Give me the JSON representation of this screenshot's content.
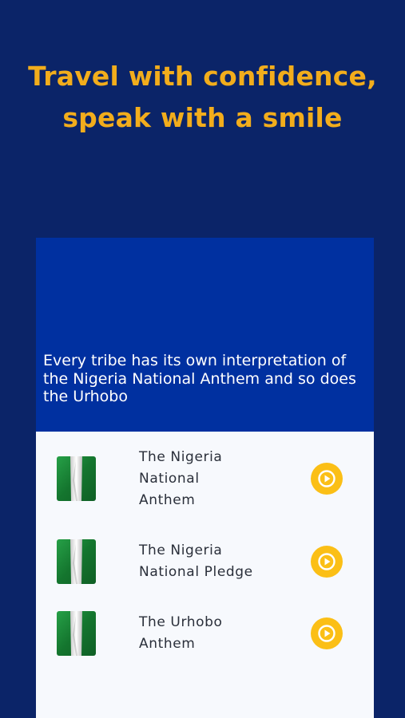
{
  "headline": {
    "line1": "Travel with confidence,",
    "line2": "speak with a smile"
  },
  "banner": {
    "text": "Every tribe has its own interpretation of the Nigeria National Anthem and so does the Urhobo"
  },
  "items": [
    {
      "label_lines": [
        "The Nigeria",
        "National",
        "Anthem"
      ],
      "icon": "nigeria-flag-icon",
      "action_icon": "play-icon"
    },
    {
      "label_lines": [
        "The Nigeria",
        "National Pledge"
      ],
      "icon": "nigeria-flag-icon",
      "action_icon": "play-icon"
    },
    {
      "label_lines": [
        "The Urhobo",
        "Anthem"
      ],
      "icon": "nigeria-flag-icon",
      "action_icon": "play-icon"
    }
  ],
  "colors": {
    "background": "#0b2468",
    "headline": "#f2ad1c",
    "banner": "#0030a0",
    "card": "#f7f9fd",
    "play_button": "#fbbf16",
    "flag_green": "#1f8a3b",
    "flag_white": "#f2f2f2"
  }
}
